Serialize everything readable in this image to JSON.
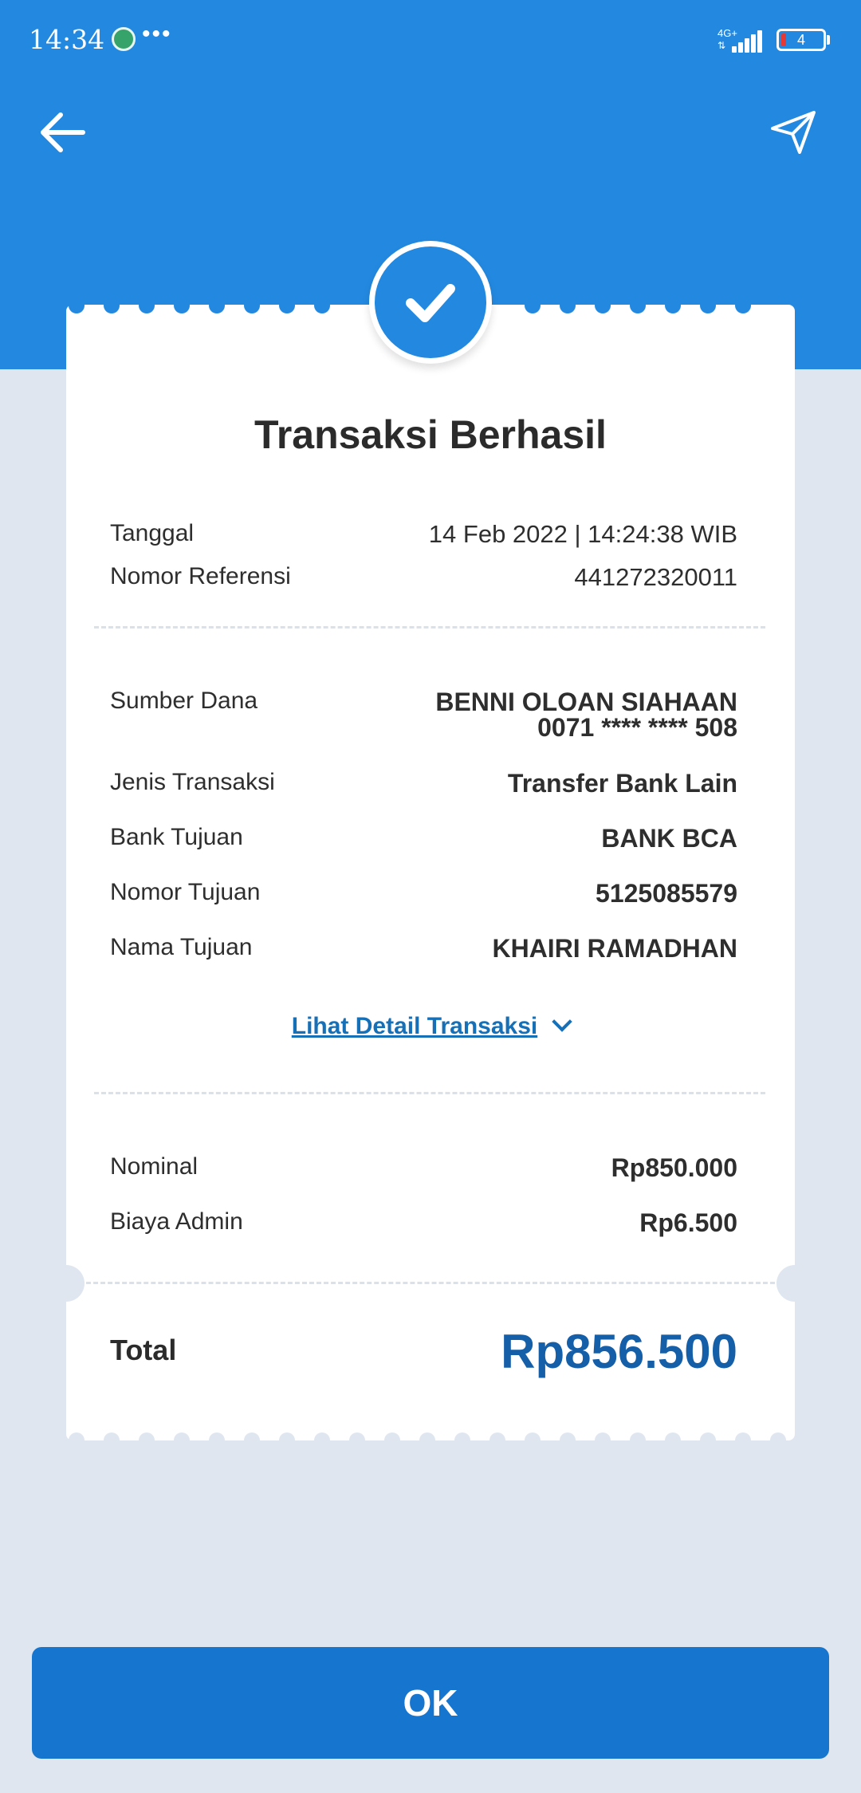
{
  "status_bar": {
    "time": "14:34",
    "network": "4G+",
    "battery": "4"
  },
  "colors": {
    "primary": "#2389e0",
    "button": "#1676cf",
    "total": "#155fa9",
    "link": "#1670b8",
    "background": "#dfe6ef"
  },
  "icons": {
    "back": "arrow-left-icon",
    "share": "send-icon",
    "success": "check-circle-icon",
    "expand": "chevron-down-icon"
  },
  "receipt": {
    "title": "Transaksi Berhasil",
    "meta": [
      {
        "label": "Tanggal",
        "value": "14 Feb 2022 | 14:24:38 WIB"
      },
      {
        "label": "Nomor Referensi",
        "value": "441272320011"
      }
    ],
    "details": {
      "source_label": "Sumber Dana",
      "source_name": "BENNI OLOAN SIAHAAN",
      "source_account": "0071 **** **** 508",
      "rows": [
        {
          "label": "Jenis Transaksi",
          "value": "Transfer Bank Lain"
        },
        {
          "label": "Bank Tujuan",
          "value": "BANK BCA"
        },
        {
          "label": "Nomor Tujuan",
          "value": "5125085579"
        },
        {
          "label": "Nama Tujuan",
          "value": "KHAIRI RAMADHAN"
        }
      ]
    },
    "detail_link": "Lihat Detail Transaksi",
    "amounts": [
      {
        "label": "Nominal",
        "value": "Rp850.000"
      },
      {
        "label": "Biaya Admin",
        "value": "Rp6.500"
      }
    ],
    "total_label": "Total",
    "total_value": "Rp856.500"
  },
  "ok_button": "OK"
}
